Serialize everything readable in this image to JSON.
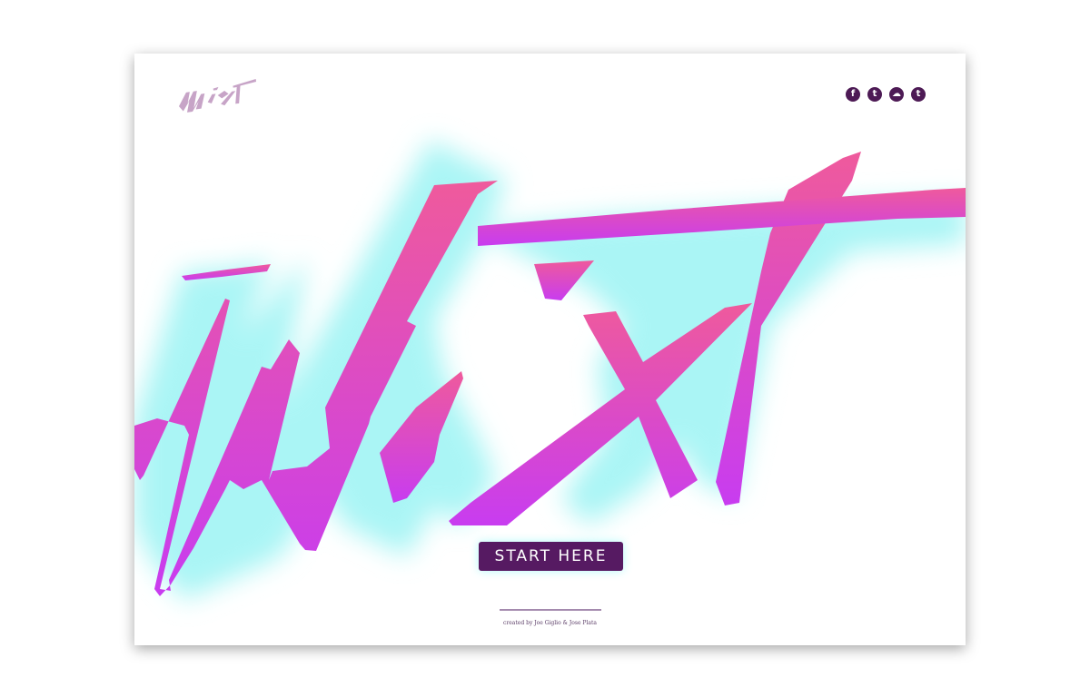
{
  "brand": {
    "logo_text": "Mixt",
    "logo_small_color": "#c7a4c7",
    "glow_color": "#aaf5f5",
    "gradient_top": "#ef5a9c",
    "gradient_bottom": "#c83cf0"
  },
  "social": [
    {
      "icon": "facebook-icon",
      "glyph": "f"
    },
    {
      "icon": "twitter-icon",
      "glyph": "t"
    },
    {
      "icon": "soundcloud-icon",
      "glyph": "☁"
    },
    {
      "icon": "tumblr-icon",
      "glyph": "t"
    }
  ],
  "cta": {
    "label": "START HERE",
    "color": "#561a62"
  },
  "footer": {
    "credit": "created by Joe Giglio & Jose Plata"
  }
}
